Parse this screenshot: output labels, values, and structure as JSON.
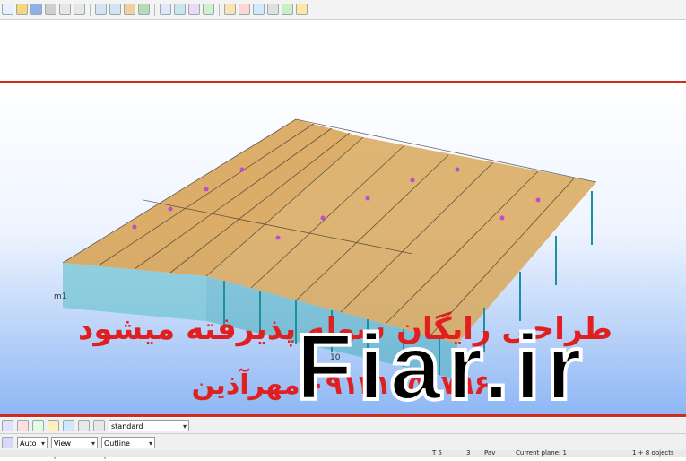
{
  "toolbar": {
    "icons": [
      "new-icon",
      "open-icon",
      "save-icon",
      "print-icon",
      "undo-icon",
      "redo-icon",
      "cut-icon",
      "copy-icon",
      "paste-icon",
      "measure-icon",
      "select-icon",
      "zoom-icon",
      "pan-icon",
      "rotate-icon",
      "grid-icon",
      "snap-icon",
      "layer-icon",
      "render-icon",
      "settings-icon",
      "help-icon"
    ]
  },
  "overlay": {
    "persian_line1": "طراحی رایگان سوله پذیرفته میشود",
    "persian_line2": "۰۹۱۲۱۵۵۱۷۹۶ مهرآذین",
    "watermark": "Fiar.ir"
  },
  "model_labels": {
    "left_tag": "m1",
    "center_tag": "10"
  },
  "bottom_toolbar": {
    "standard_select": "standard",
    "auto_select": "Auto",
    "view_plane_select": "View plane",
    "outline_select": "Outline planes"
  },
  "status": {
    "scale": "T 5",
    "val": "3",
    "mode": "Pav",
    "plane": "Current plane: 1",
    "selection": "1 + 8 objects"
  },
  "colors": {
    "frame_red": "#d42a1c",
    "overlay_red": "#e02020",
    "roof_orange": "#d7a04f",
    "steel_cyan": "#3fb6c7",
    "purlin_magenta": "#c04bd0"
  }
}
